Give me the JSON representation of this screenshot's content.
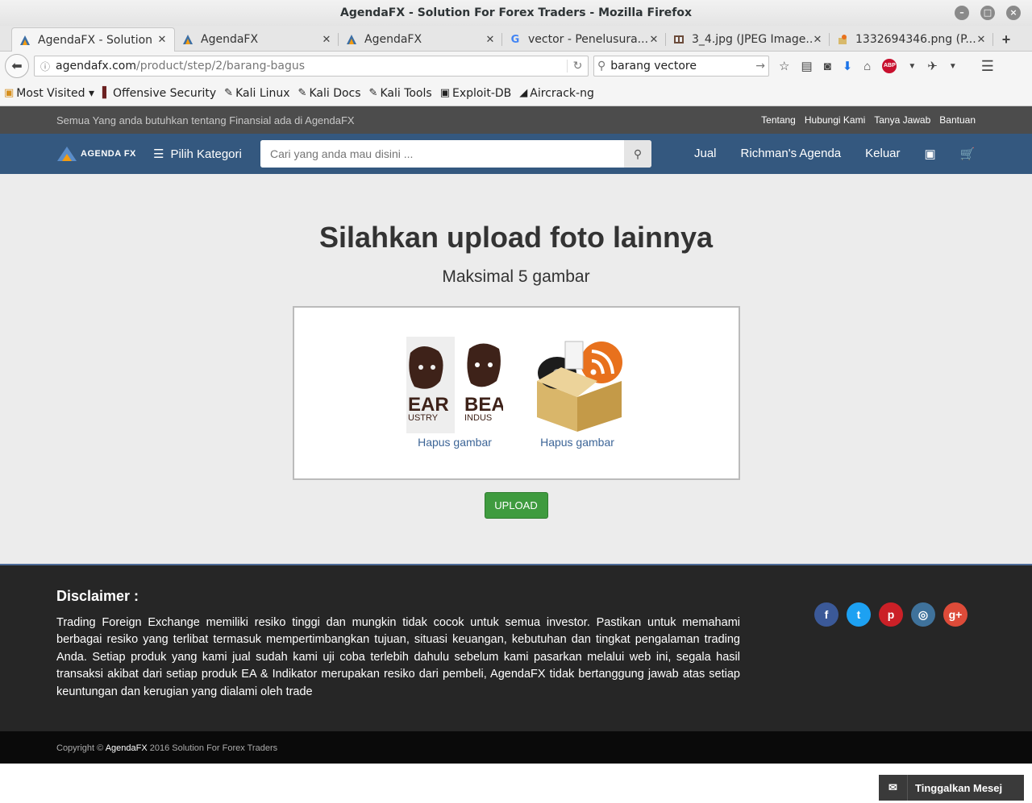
{
  "window": {
    "title": "AgendaFX - Solution For Forex Traders - Mozilla Firefox"
  },
  "tabs": [
    {
      "label": "AgendaFX - Solution Fo...",
      "icon": "agendafx-favicon"
    },
    {
      "label": "AgendaFX",
      "icon": "agendafx-favicon"
    },
    {
      "label": "AgendaFX",
      "icon": "agendafx-favicon"
    },
    {
      "label": "vector - Penelusura...",
      "icon": "google-favicon"
    },
    {
      "label": "3_4.jpg (JPEG Image...",
      "icon": "image-favicon"
    },
    {
      "label": "1332694346.png (P...",
      "icon": "image-favicon"
    }
  ],
  "urlbar": {
    "host": "agendafx.com",
    "path": "/product/step/2/barang-bagus"
  },
  "browser_search": {
    "value": "barang vectore"
  },
  "bookmarks": [
    {
      "label": "Most Visited ▾",
      "icon": "folder-icon"
    },
    {
      "label": "Offensive Security",
      "icon": "offsec-icon"
    },
    {
      "label": "Kali Linux",
      "icon": "kali-icon"
    },
    {
      "label": "Kali Docs",
      "icon": "kali-icon"
    },
    {
      "label": "Kali Tools",
      "icon": "kali-icon"
    },
    {
      "label": "Exploit-DB",
      "icon": "exploitdb-icon"
    },
    {
      "label": "Aircrack-ng",
      "icon": "aircrack-icon"
    }
  ],
  "site": {
    "tagline": "Semua Yang anda butuhkan tentang Finansial ada di AgendaFX",
    "top_links": [
      "Tentang",
      "Hubungi Kami",
      "Tanya Jawab",
      "Bantuan"
    ],
    "logo_text": "AGENDA FX",
    "category_label": "Pilih Kategori",
    "search_placeholder": "Cari yang anda mau disini ...",
    "nav_links": [
      "Jual",
      "Richman's Agenda",
      "Keluar"
    ],
    "colors": {
      "topstrip": "#4c4c4c",
      "nav": "#34587f",
      "upload_button": "#3f9b3f",
      "footer": "#262626"
    }
  },
  "main": {
    "heading": "Silahkan upload foto lainnya",
    "subheading": "Maksimal 5 gambar",
    "images": [
      {
        "alt": "bear industry logo",
        "remove_label": "Hapus gambar"
      },
      {
        "alt": "rss box icon",
        "remove_label": "Hapus gambar"
      }
    ],
    "upload_label": "UPLOAD"
  },
  "footer": {
    "disclaimer_title": "Disclaimer :",
    "disclaimer_text": "Trading Foreign Exchange memiliki resiko tinggi dan mungkin tidak cocok untuk semua investor. Pastikan untuk memahami berbagai resiko yang terlibat termasuk mempertimbangkan tujuan, situasi keuangan, kebutuhan dan tingkat pengalaman trading Anda. Setiap produk yang kami jual sudah kami uji coba terlebih dahulu sebelum kami pasarkan melalui web ini, segala hasil transaksi akibat dari setiap produk EA & Indikator merupakan resiko dari pembeli, AgendaFX tidak bertanggung jawab atas setiap keuntungan dan kerugian yang dialami oleh trade",
    "social": [
      {
        "icon": "facebook-icon",
        "glyph": "f",
        "color": "#3b5998"
      },
      {
        "icon": "twitter-icon",
        "glyph": "t",
        "color": "#1da1f2"
      },
      {
        "icon": "pinterest-icon",
        "glyph": "p",
        "color": "#cb2027"
      },
      {
        "icon": "instagram-icon",
        "glyph": "◎",
        "color": "#3f729b"
      },
      {
        "icon": "googleplus-icon",
        "glyph": "g+",
        "color": "#dd4b39"
      }
    ]
  },
  "copyright": {
    "prefix": "Copyright ©",
    "brand": "AgendaFX",
    "suffix": "2016 Solution For Forex Traders"
  },
  "chat": {
    "label": "Tinggalkan Mesej"
  }
}
